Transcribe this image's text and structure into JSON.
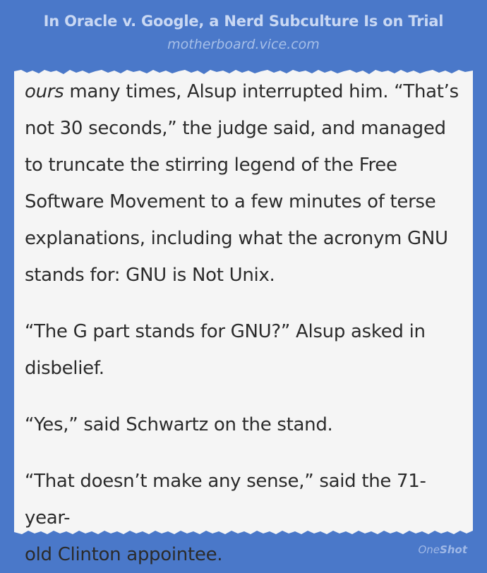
{
  "header": {
    "headline": "In Oracle v. Google, a Nerd Subculture Is on Trial",
    "source": "motherboard.vice.com"
  },
  "excerpt": {
    "p1_em": "ours",
    "p1_line1_rest": " many times, Alsup interrupted him. “That’s",
    "p1_line2": "not 30 seconds,” the judge said, and managed",
    "p1_line3": "to truncate the stirring legend of the Free",
    "p1_line4": "Software Movement to a few minutes of terse",
    "p1_line5": "explanations, including what the acronym GNU",
    "p1_line6": "stands for: GNU is Not Unix.",
    "p2_line1": "“The G part stands for GNU?” Alsup asked in",
    "p2_line2": "disbelief.",
    "p3_line1": "“Yes,” said Schwartz on the stand.",
    "p4_line1": "“That doesn’t make any sense,” said the 71-year-",
    "p4_line2": "old Clinton appointee."
  },
  "footer": {
    "brand_one": "One",
    "brand_shot": "Shot"
  },
  "colors": {
    "background": "#4a78c9",
    "paper": "#f5f5f5",
    "text": "#2b2b2b"
  }
}
